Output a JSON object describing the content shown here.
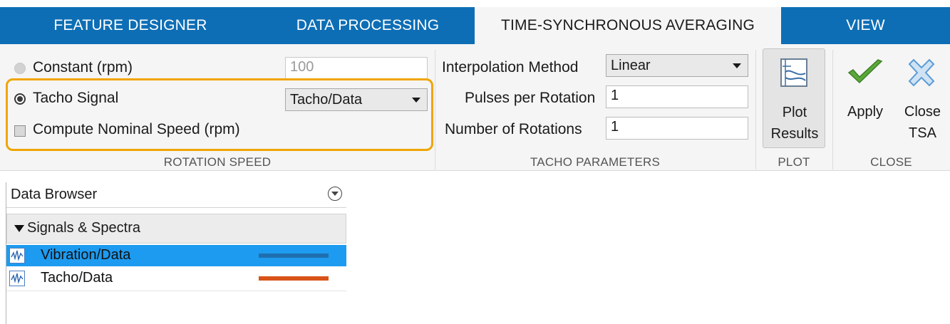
{
  "tabs": [
    {
      "label": "FEATURE DESIGNER",
      "active": false
    },
    {
      "label": "DATA PROCESSING",
      "active": false
    },
    {
      "label": "TIME-SYNCHRONOUS AVERAGING",
      "active": true
    },
    {
      "label": "VIEW",
      "active": false
    }
  ],
  "rotation_speed": {
    "section_label": "ROTATION SPEED",
    "constant_label": "Constant (rpm)",
    "constant_value": "100",
    "tacho_label": "Tacho Signal",
    "tacho_selected": "Tacho/Data",
    "nominal_label": "Compute Nominal Speed (rpm)"
  },
  "tacho_parameters": {
    "section_label": "TACHO PARAMETERS",
    "interp_label": "Interpolation Method",
    "interp_selected": "Linear",
    "pulses_label": "Pulses per Rotation",
    "pulses_value": "1",
    "rotations_label": "Number of Rotations",
    "rotations_value": "1"
  },
  "plot": {
    "section_label": "PLOT",
    "button_line1": "Plot",
    "button_line2": "Results"
  },
  "close": {
    "section_label": "CLOSE",
    "apply_label": "Apply",
    "close_line1": "Close",
    "close_line2": "TSA"
  },
  "data_browser": {
    "title": "Data Browser",
    "group_label": "Signals & Spectra",
    "signals": [
      {
        "label": "Vibration/Data",
        "selected": true,
        "color": "#1f6fb0"
      },
      {
        "label": "Tacho/Data",
        "selected": false,
        "color": "#d95319"
      }
    ]
  },
  "colors": {
    "tab_blue": "#0d6eb5",
    "highlight_orange": "#f0a500",
    "selection_blue": "#1d9bf0",
    "apply_green": "#5aa83a",
    "close_blue": "#5b9bd5"
  }
}
